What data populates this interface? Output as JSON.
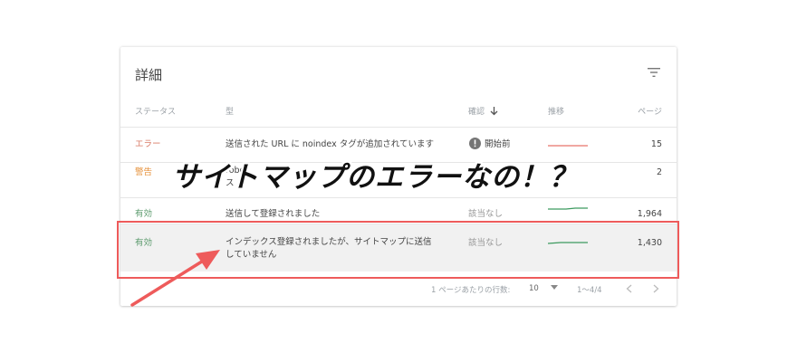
{
  "card": {
    "title": "詳細",
    "filter_icon": "filter-icon"
  },
  "columns": {
    "status": "ステータス",
    "type": "型",
    "confirm": "確認",
    "trend": "推移",
    "pages": "ページ"
  },
  "rows": [
    {
      "status": "エラー",
      "type_line1": "送信された URL に noindex タグが追加されています",
      "type_line2": "",
      "confirm": "開始前",
      "pages": "15",
      "trend_color": "#e8746a"
    },
    {
      "status": "警告",
      "type_line1": "robo",
      "type_line2": "ス",
      "confirm": "",
      "pages": "2",
      "trend_color": "#e6913a"
    },
    {
      "status": "有効",
      "type_line1": "送信して登録されました",
      "type_line2": "",
      "confirm": "該当なし",
      "pages": "1,964",
      "trend_color": "#3c9a5f"
    },
    {
      "status": "有効",
      "type_line1": "インデックス登録されましたが、サイトマップに送信",
      "type_line2": "していません",
      "confirm": "該当なし",
      "pages": "1,430",
      "trend_color": "#3c9a5f"
    }
  ],
  "pagination": {
    "rows_per_page_label": "1 ページあたりの行数:",
    "rows_per_page_value": "10",
    "range": "1〜4/4"
  },
  "overlay": {
    "text": "サイトマップのエラーなの！？"
  },
  "colors": {
    "highlight": "#ee5b5b",
    "arrow": "#ee5b5b"
  }
}
